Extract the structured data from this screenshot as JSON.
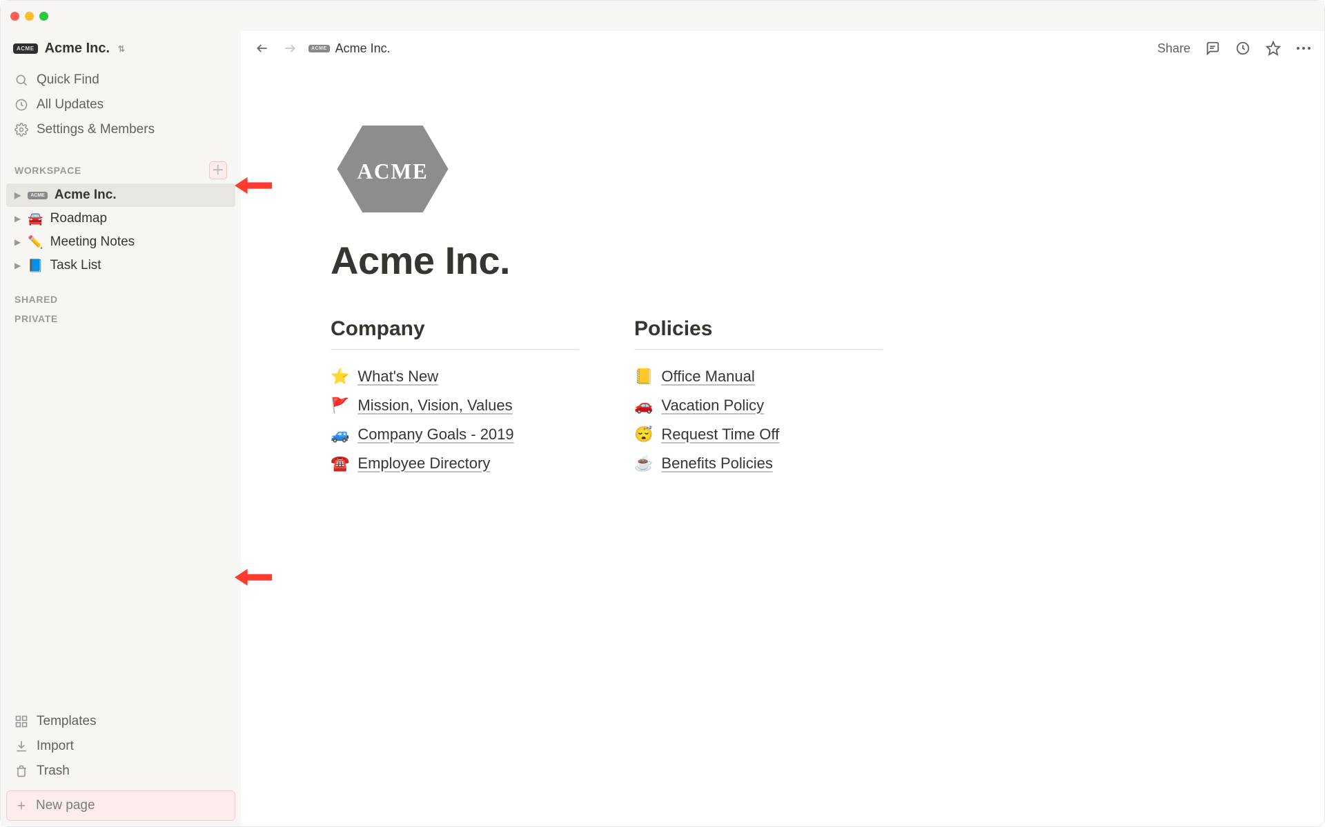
{
  "workspace": {
    "name": "Acme Inc.",
    "badge": "ACME"
  },
  "sidebar": {
    "quickfind": "Quick Find",
    "updates": "All Updates",
    "settings": "Settings & Members",
    "section_workspace": "WORKSPACE",
    "section_shared": "SHARED",
    "section_private": "PRIVATE",
    "pages": [
      {
        "emoji_badge": "ACME",
        "label": "Acme Inc.",
        "active": true
      },
      {
        "emoji": "🚘",
        "label": "Roadmap"
      },
      {
        "emoji": "✏️",
        "label": "Meeting Notes"
      },
      {
        "emoji": "📘",
        "label": "Task List"
      }
    ],
    "templates": "Templates",
    "import": "Import",
    "trash": "Trash",
    "newpage": "New page"
  },
  "topbar": {
    "crumb_badge": "ACME",
    "crumb": "Acme Inc.",
    "share": "Share"
  },
  "page": {
    "logo_text": "ACME",
    "title": "Acme Inc.",
    "columns": [
      {
        "heading": "Company",
        "links": [
          {
            "emoji": "⭐",
            "text": "What's New"
          },
          {
            "emoji": "🚩",
            "text": "Mission, Vision, Values"
          },
          {
            "emoji": "🚙",
            "text": "Company Goals - 2019"
          },
          {
            "emoji": "☎️",
            "text": "Employee Directory"
          }
        ]
      },
      {
        "heading": "Policies",
        "links": [
          {
            "emoji": "📒",
            "text": "Office Manual"
          },
          {
            "emoji": "🚗",
            "text": "Vacation Policy"
          },
          {
            "emoji": "😴",
            "text": "Request Time Off"
          },
          {
            "emoji": "☕",
            "text": "Benefits Policies"
          }
        ]
      }
    ]
  }
}
